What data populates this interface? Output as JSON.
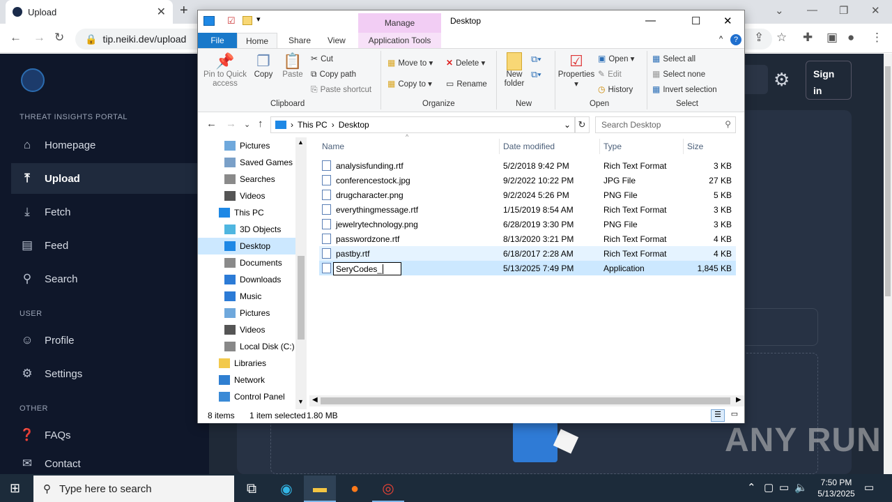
{
  "browser": {
    "tab_title": "Upload",
    "url": "tip.neiki.dev/upload"
  },
  "site": {
    "portal_label": "THREAT INSIGHTS PORTAL",
    "nav": [
      {
        "label": "Homepage",
        "icon": "home-icon"
      },
      {
        "label": "Upload",
        "icon": "upload-icon",
        "active": true
      },
      {
        "label": "Fetch",
        "icon": "fetch-icon"
      },
      {
        "label": "Feed",
        "icon": "feed-icon"
      },
      {
        "label": "Search",
        "icon": "search-icon"
      }
    ],
    "user_label": "USER",
    "user_nav": [
      {
        "label": "Profile",
        "icon": "profile-icon"
      },
      {
        "label": "Settings",
        "icon": "settings-icon"
      }
    ],
    "other_label": "OTHER",
    "other_nav": [
      {
        "label": "FAQs",
        "icon": "faq-icon"
      },
      {
        "label": "Contact",
        "icon": "contact-icon"
      }
    ],
    "signin_label": "Sign in"
  },
  "explorer": {
    "title": "Desktop",
    "manage_label": "Manage",
    "tabs": {
      "file": "File",
      "home": "Home",
      "share": "Share",
      "view": "View",
      "app_tools": "Application Tools"
    },
    "ribbon": {
      "pin": "Pin to Quick access",
      "copy": "Copy",
      "paste": "Paste",
      "cut": "Cut",
      "copy_path": "Copy path",
      "paste_shortcut": "Paste shortcut",
      "clipboard": "Clipboard",
      "move_to": "Move to",
      "copy_to": "Copy to",
      "delete": "Delete",
      "rename": "Rename",
      "organize": "Organize",
      "new_folder": "New folder",
      "new": "New",
      "properties": "Properties",
      "open": "Open",
      "edit": "Edit",
      "history": "History",
      "open_group": "Open",
      "select_all": "Select all",
      "select_none": "Select none",
      "invert_selection": "Invert selection",
      "select_group": "Select"
    },
    "address": {
      "this_pc": "This PC",
      "desktop": "Desktop",
      "search_placeholder": "Search Desktop"
    },
    "nav_pane": [
      {
        "label": "Pictures",
        "indent": 2
      },
      {
        "label": "Saved Games",
        "indent": 2
      },
      {
        "label": "Searches",
        "indent": 2
      },
      {
        "label": "Videos",
        "indent": 2
      },
      {
        "label": "This PC",
        "indent": 1
      },
      {
        "label": "3D Objects",
        "indent": 2
      },
      {
        "label": "Desktop",
        "indent": 2,
        "selected": true
      },
      {
        "label": "Documents",
        "indent": 2
      },
      {
        "label": "Downloads",
        "indent": 2
      },
      {
        "label": "Music",
        "indent": 2
      },
      {
        "label": "Pictures",
        "indent": 2
      },
      {
        "label": "Videos",
        "indent": 2
      },
      {
        "label": "Local Disk (C:)",
        "indent": 2
      },
      {
        "label": "Libraries",
        "indent": 1
      },
      {
        "label": "Network",
        "indent": 1
      },
      {
        "label": "Control Panel",
        "indent": 1
      }
    ],
    "columns": {
      "name": "Name",
      "date": "Date modified",
      "type": "Type",
      "size": "Size"
    },
    "files": [
      {
        "name": "analysisfunding.rtf",
        "date": "5/2/2018 9:42 PM",
        "type": "Rich Text Format",
        "size": "3 KB"
      },
      {
        "name": "conferencestock.jpg",
        "date": "9/2/2022 10:22 PM",
        "type": "JPG File",
        "size": "27 KB"
      },
      {
        "name": "drugcharacter.png",
        "date": "9/2/2024 5:26 PM",
        "type": "PNG File",
        "size": "5 KB"
      },
      {
        "name": "everythingmessage.rtf",
        "date": "1/15/2019 8:54 AM",
        "type": "Rich Text Format",
        "size": "3 KB"
      },
      {
        "name": "jewelrytechnology.png",
        "date": "6/28/2019 3:30 PM",
        "type": "PNG File",
        "size": "3 KB"
      },
      {
        "name": "passwordzone.rtf",
        "date": "8/13/2020 3:21 PM",
        "type": "Rich Text Format",
        "size": "4 KB"
      },
      {
        "name": "pastby.rtf",
        "date": "6/18/2017 2:28 AM",
        "type": "Rich Text Format",
        "size": "4 KB"
      },
      {
        "name": "SeryCodes_",
        "date": "5/13/2025 7:49 PM",
        "type": "Application",
        "size": "1,845 KB"
      }
    ],
    "status": {
      "items": "8 items",
      "selected": "1 item selected",
      "size": "1.80 MB"
    }
  },
  "taskbar": {
    "search_placeholder": "Type here to search",
    "time": "7:50 PM",
    "date": "5/13/2025"
  },
  "watermark": "ANY RUN"
}
